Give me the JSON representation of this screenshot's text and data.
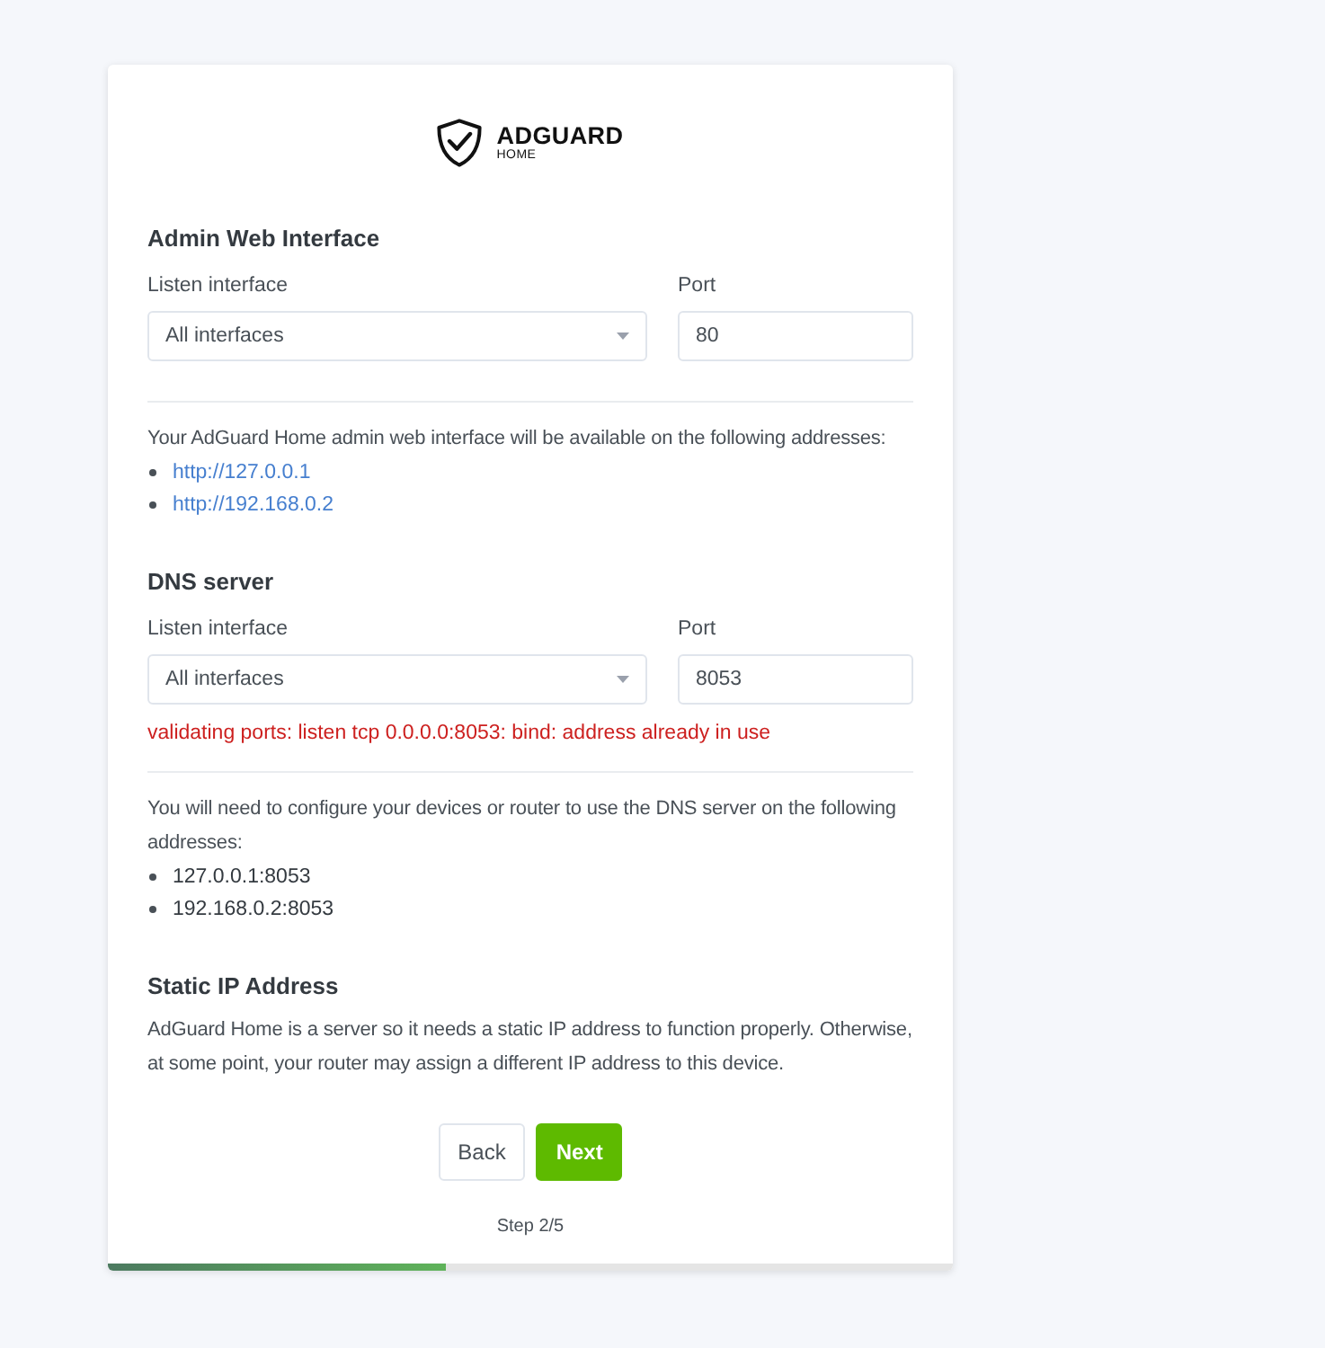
{
  "logo": {
    "name": "ADGUARD",
    "subtitle": "HOME"
  },
  "sections": [
    {
      "kind": "listen",
      "title": "Admin Web Interface",
      "interface_label": "Listen interface",
      "interface_value": "All interfaces",
      "port_label": "Port",
      "port_value": "80",
      "note": "Your AdGuard Home admin web interface will be available on the following addresses:",
      "addresses": [
        {
          "kind": "link",
          "text": "http://127.0.0.1"
        },
        {
          "kind": "link",
          "text": "http://192.168.0.2"
        }
      ]
    },
    {
      "kind": "listen",
      "title": "DNS server",
      "interface_label": "Listen interface",
      "interface_value": "All interfaces",
      "port_label": "Port",
      "port_value": "8053",
      "error": "validating ports: listen tcp 0.0.0.0:8053: bind: address already in use",
      "note": "You will need to configure your devices or router to use the DNS server on the following addresses:",
      "addresses": [
        {
          "kind": "plain",
          "text": "127.0.0.1:8053"
        },
        {
          "kind": "plain",
          "text": "192.168.0.2:8053"
        }
      ]
    },
    {
      "kind": "info",
      "title": "Static IP Address",
      "text": "AdGuard Home is a server so it needs a static IP address to function properly. Otherwise, at some point, your router may assign a different IP address to this device."
    }
  ],
  "buttons": [
    {
      "kind": "secondary",
      "label": "Back"
    },
    {
      "kind": "primary",
      "label": "Next"
    }
  ],
  "step": "Step 2/5",
  "progress": {
    "level": 0.4
  }
}
